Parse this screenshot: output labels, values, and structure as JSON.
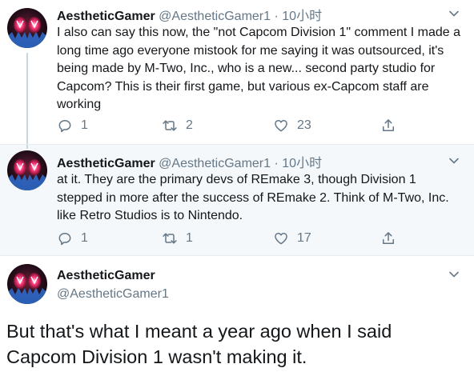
{
  "tweets": [
    {
      "name": "AestheticGamer",
      "handle": "@AestheticGamer1",
      "dot": "·",
      "time": "10小时",
      "text": "I also can say this now, the \"not Capcom Division 1\" comment I made a long time ago everyone mistook for me saying it was outsourced, it's being made by M-Two, Inc., who is a new... second party studio for Capcom? This is their first game, but various ex-Capcom staff are working",
      "replies": "1",
      "retweets": "2",
      "likes": "23"
    },
    {
      "name": "AestheticGamer",
      "handle": "@AestheticGamer1",
      "dot": "·",
      "time": "10小时",
      "text": "at it. They are the primary devs of REmake 3, though Division 1 stepped in more after the success of REmake 2. Think of M-Two, Inc. like Retro Studios is to Nintendo.",
      "replies": "1",
      "retweets": "1",
      "likes": "17"
    },
    {
      "name": "AestheticGamer",
      "handle": "@AestheticGamer1",
      "text": "But that's what I meant a year ago when I said Capcom Division 1 wasn't making it."
    }
  ],
  "icons": {
    "reply": "reply-icon",
    "retweet": "retweet-icon",
    "like": "like-icon",
    "share": "share-icon",
    "more": "chevron-down-icon",
    "avatar": "avatar"
  },
  "colors": {
    "secondary_text": "#657786",
    "highlight_bg": "#f5f8fa",
    "border": "#e6ecf0",
    "avatar_glow": "#e0245e"
  }
}
